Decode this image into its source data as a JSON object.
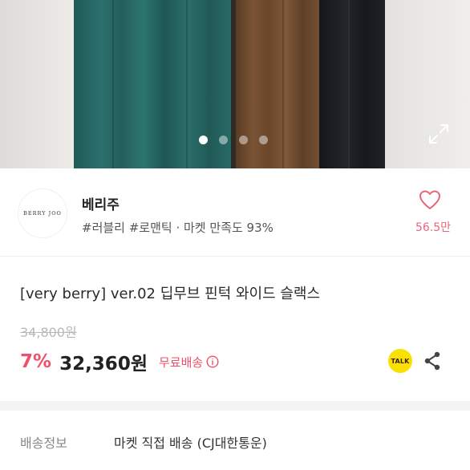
{
  "gallery": {
    "dots_count": 4,
    "active_dot": 0,
    "expand_icon": "expand-icon"
  },
  "seller": {
    "logo_text": "BERRY JOO",
    "name": "베리주",
    "tags": "#러블리 #로맨틱 · 마켓 만족도 93%",
    "like_icon": "heart-icon",
    "like_count": "56.5만",
    "like_color": "#e8657c"
  },
  "product": {
    "title": "[very berry] ver.02 딥무브 핀턱 와이드 슬랙스",
    "original_price": "34,800원",
    "discount": "7%",
    "price": "32,360원",
    "shipping_badge": "무료배송",
    "accent_color": "#f2506a"
  },
  "actions": {
    "talk_label": "TALK",
    "share_icon": "share-icon"
  },
  "delivery": {
    "label": "배송정보",
    "value": "마켓 직접 배송 (CJ대한통운)"
  }
}
